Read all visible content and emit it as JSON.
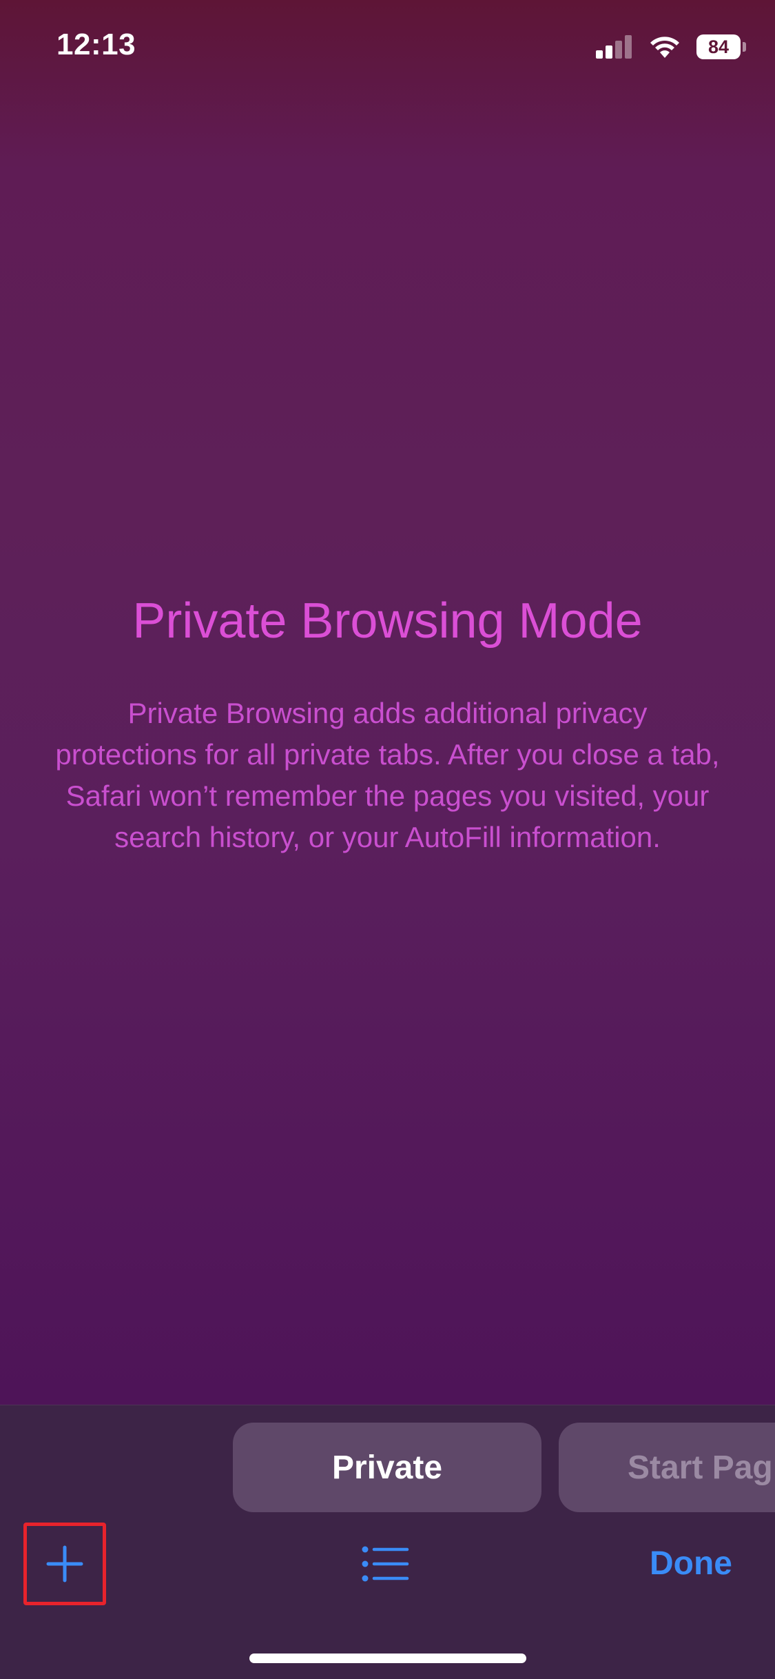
{
  "status_bar": {
    "time": "12:13",
    "battery_level": "84",
    "signal_icon": "cellular-signal-icon",
    "wifi_icon": "wifi-icon",
    "battery_icon": "battery-icon"
  },
  "private_mode": {
    "title": "Private Browsing Mode",
    "description": "Private Browsing adds additional privacy protections for all private tabs. After you close a tab, Safari won’t remember the pages you visited, your search history, or your AutoFill information."
  },
  "tab_groups": [
    {
      "label": "Private",
      "selected": true
    },
    {
      "label": "Start Pag",
      "selected": false
    }
  ],
  "toolbar": {
    "new_tab_icon": "plus-icon",
    "tab_list_icon": "list-icon",
    "done_label": "Done"
  },
  "colors": {
    "accent": "#3a8cf7",
    "private_title": "#db4fd6",
    "private_text": "#c94fcf",
    "toolbar_bg": "#3d2447",
    "highlight": "#e8232c"
  }
}
